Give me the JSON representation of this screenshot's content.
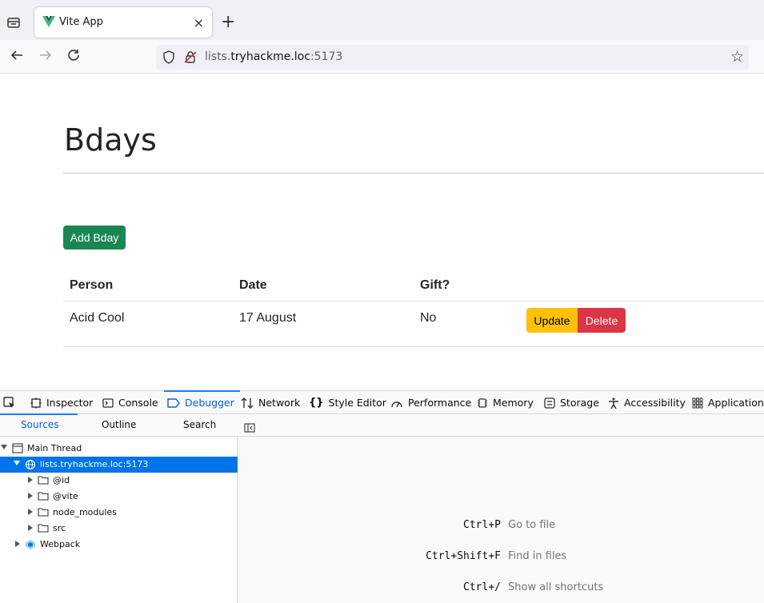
{
  "browser": {
    "tab_title": "Vite App",
    "tab_close": "×",
    "new_tab": "+",
    "url_subdomain": "lists.",
    "url_host": "tryhackme.loc",
    "url_port": ":5173"
  },
  "page": {
    "heading": "Bdays",
    "add_button": "Add Bday",
    "columns": [
      "Person",
      "Date",
      "Gift?"
    ],
    "rows": [
      {
        "person": "Acid Cool",
        "date": "17 August",
        "gift": "No",
        "update": "Update",
        "delete": "Delete"
      }
    ],
    "colors": {
      "add": "#198754",
      "update": "#ffc107",
      "delete": "#dc3545"
    }
  },
  "devtools": {
    "tabs": [
      "Inspector",
      "Console",
      "Debugger",
      "Network",
      "Style Editor",
      "Performance",
      "Memory",
      "Storage",
      "Accessibility",
      "Application"
    ],
    "active_tab": "Debugger",
    "subtabs": [
      "Sources",
      "Outline",
      "Search"
    ],
    "active_subtab": "Sources",
    "tree": {
      "thread": "Main Thread",
      "origin": "lists.tryhackme.loc:5173",
      "folders": [
        "@id",
        "@vite",
        "node_modules",
        "src"
      ],
      "webpack": "Webpack"
    },
    "shortcuts": [
      {
        "key": "Ctrl+P",
        "label": "Go to file"
      },
      {
        "key": "Ctrl+Shift+F",
        "label": "Find in files"
      },
      {
        "key": "Ctrl+/",
        "label": "Show all shortcuts"
      }
    ]
  }
}
